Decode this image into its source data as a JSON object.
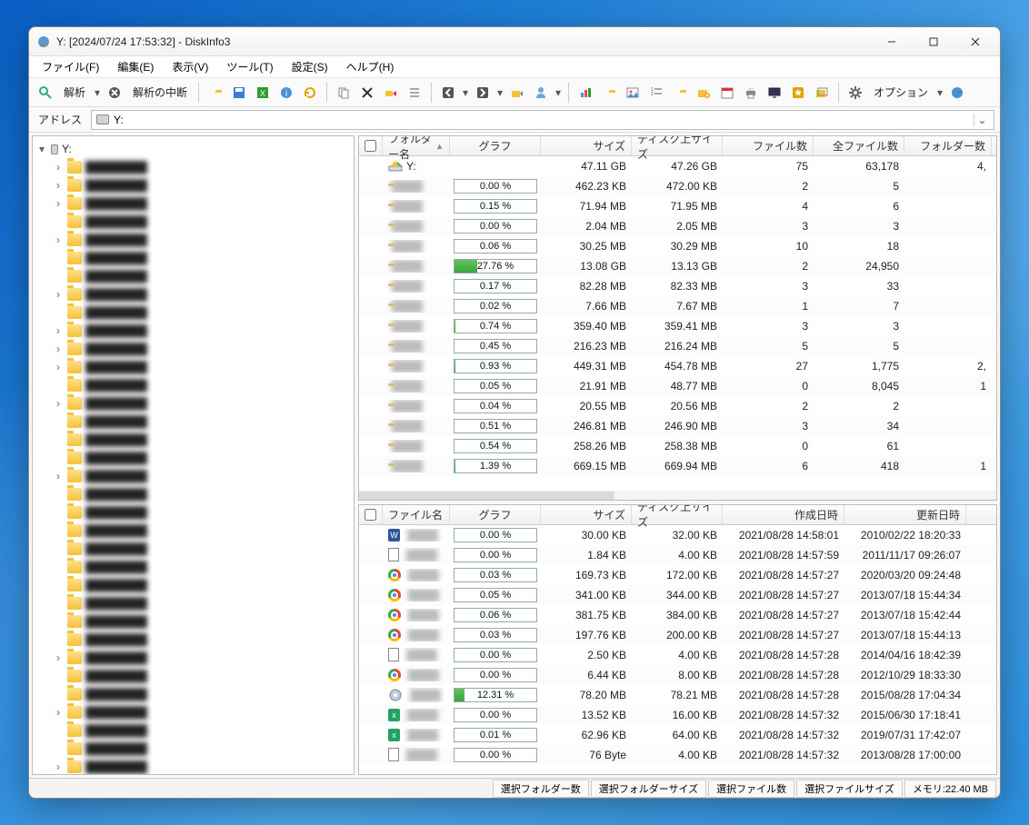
{
  "title": "Y: [2024/07/24 17:53:32] - DiskInfo3",
  "menu": [
    "ファイル(F)",
    "編集(E)",
    "表示(V)",
    "ツール(T)",
    "設定(S)",
    "ヘルプ(H)"
  ],
  "toolbar": {
    "analyze": "解析",
    "abort": "解析の中断",
    "options": "オプション"
  },
  "address": {
    "label": "アドレス",
    "value": "Y:"
  },
  "tree": {
    "root": "Y:"
  },
  "folderPane": {
    "headers": {
      "name": "フォルダー名",
      "graph": "グラフ",
      "size": "サイズ",
      "dsize": "ディスク上サイズ",
      "files": "ファイル数",
      "allfiles": "全ファイル数",
      "folders": "フォルダー数"
    },
    "rows": [
      {
        "icon": "drive",
        "name": "Y:",
        "pct": null,
        "size": "47.11 GB",
        "dsize": "47.26 GB",
        "files": "75",
        "allfiles": "63,178",
        "folders": "4,"
      },
      {
        "icon": "folder",
        "name": "",
        "pct": "0.00 %",
        "fill": 0,
        "size": "462.23 KB",
        "dsize": "472.00 KB",
        "files": "2",
        "allfiles": "5",
        "folders": ""
      },
      {
        "icon": "folder",
        "name": "",
        "pct": "0.15 %",
        "fill": 0.15,
        "size": "71.94 MB",
        "dsize": "71.95 MB",
        "files": "4",
        "allfiles": "6",
        "folders": ""
      },
      {
        "icon": "folder",
        "name": "",
        "pct": "0.00 %",
        "fill": 0,
        "size": "2.04 MB",
        "dsize": "2.05 MB",
        "files": "3",
        "allfiles": "3",
        "folders": ""
      },
      {
        "icon": "folder",
        "name": "",
        "pct": "0.06 %",
        "fill": 0.06,
        "size": "30.25 MB",
        "dsize": "30.29 MB",
        "files": "10",
        "allfiles": "18",
        "folders": ""
      },
      {
        "icon": "folder",
        "name": "",
        "pct": "27.76 %",
        "fill": 27.76,
        "size": "13.08 GB",
        "dsize": "13.13 GB",
        "files": "2",
        "allfiles": "24,950",
        "folders": ""
      },
      {
        "icon": "folder",
        "name": "",
        "pct": "0.17 %",
        "fill": 0.17,
        "size": "82.28 MB",
        "dsize": "82.33 MB",
        "files": "3",
        "allfiles": "33",
        "folders": ""
      },
      {
        "icon": "folder",
        "name": "",
        "pct": "0.02 %",
        "fill": 0.02,
        "size": "7.66 MB",
        "dsize": "7.67 MB",
        "files": "1",
        "allfiles": "7",
        "folders": ""
      },
      {
        "icon": "folder",
        "name": "",
        "pct": "0.74 %",
        "fill": 0.74,
        "size": "359.40 MB",
        "dsize": "359.41 MB",
        "files": "3",
        "allfiles": "3",
        "folders": ""
      },
      {
        "icon": "folder",
        "name": "",
        "pct": "0.45 %",
        "fill": 0.45,
        "size": "216.23 MB",
        "dsize": "216.24 MB",
        "files": "5",
        "allfiles": "5",
        "folders": ""
      },
      {
        "icon": "folder",
        "name": "",
        "pct": "0.93 %",
        "fill": 0.93,
        "size": "449.31 MB",
        "dsize": "454.78 MB",
        "files": "27",
        "allfiles": "1,775",
        "folders": "2,"
      },
      {
        "icon": "folder",
        "name": "",
        "pct": "0.05 %",
        "fill": 0.05,
        "size": "21.91 MB",
        "dsize": "48.77 MB",
        "files": "0",
        "allfiles": "8,045",
        "folders": "1"
      },
      {
        "icon": "folder",
        "name": "",
        "pct": "0.04 %",
        "fill": 0.04,
        "size": "20.55 MB",
        "dsize": "20.56 MB",
        "files": "2",
        "allfiles": "2",
        "folders": ""
      },
      {
        "icon": "folder",
        "name": "",
        "pct": "0.51 %",
        "fill": 0.51,
        "size": "246.81 MB",
        "dsize": "246.90 MB",
        "files": "3",
        "allfiles": "34",
        "folders": ""
      },
      {
        "icon": "folder",
        "name": "",
        "pct": "0.54 %",
        "fill": 0.54,
        "size": "258.26 MB",
        "dsize": "258.38 MB",
        "files": "0",
        "allfiles": "61",
        "folders": ""
      },
      {
        "icon": "folder",
        "name": "",
        "pct": "1.39 %",
        "fill": 1.39,
        "size": "669.15 MB",
        "dsize": "669.94 MB",
        "files": "6",
        "allfiles": "418",
        "folders": "1"
      }
    ]
  },
  "filePane": {
    "headers": {
      "name": "ファイル名",
      "graph": "グラフ",
      "size": "サイズ",
      "dsize": "ディスク上サイズ",
      "cdate": "作成日時",
      "mdate": "更新日時"
    },
    "rows": [
      {
        "icon": "word",
        "pct": "0.00 %",
        "fill": 0,
        "size": "30.00 KB",
        "dsize": "32.00 KB",
        "cdate": "2021/08/28 14:58:01",
        "mdate": "2010/02/22 18:20:33"
      },
      {
        "icon": "doc",
        "pct": "0.00 %",
        "fill": 0,
        "size": "1.84 KB",
        "dsize": "4.00 KB",
        "cdate": "2021/08/28 14:57:59",
        "mdate": "2011/11/17 09:26:07"
      },
      {
        "icon": "chrome",
        "pct": "0.03 %",
        "fill": 0.03,
        "size": "169.73 KB",
        "dsize": "172.00 KB",
        "cdate": "2021/08/28 14:57:27",
        "mdate": "2020/03/20 09:24:48"
      },
      {
        "icon": "chrome",
        "pct": "0.05 %",
        "fill": 0.05,
        "size": "341.00 KB",
        "dsize": "344.00 KB",
        "cdate": "2021/08/28 14:57:27",
        "mdate": "2013/07/18 15:44:34"
      },
      {
        "icon": "chrome",
        "pct": "0.06 %",
        "fill": 0.06,
        "size": "381.75 KB",
        "dsize": "384.00 KB",
        "cdate": "2021/08/28 14:57:27",
        "mdate": "2013/07/18 15:42:44"
      },
      {
        "icon": "chrome",
        "pct": "0.03 %",
        "fill": 0.03,
        "size": "197.76 KB",
        "dsize": "200.00 KB",
        "cdate": "2021/08/28 14:57:27",
        "mdate": "2013/07/18 15:44:13"
      },
      {
        "icon": "doc",
        "pct": "0.00 %",
        "fill": 0,
        "size": "2.50 KB",
        "dsize": "4.00 KB",
        "cdate": "2021/08/28 14:57:28",
        "mdate": "2014/04/16 18:42:39"
      },
      {
        "icon": "chrome",
        "pct": "0.00 %",
        "fill": 0,
        "size": "6.44 KB",
        "dsize": "8.00 KB",
        "cdate": "2021/08/28 14:57:28",
        "mdate": "2012/10/29 18:33:30"
      },
      {
        "icon": "disk",
        "pct": "12.31 %",
        "fill": 12.31,
        "size": "78.20 MB",
        "dsize": "78.21 MB",
        "cdate": "2021/08/28 14:57:28",
        "mdate": "2015/08/28 17:04:34"
      },
      {
        "icon": "xls",
        "pct": "0.00 %",
        "fill": 0,
        "size": "13.52 KB",
        "dsize": "16.00 KB",
        "cdate": "2021/08/28 14:57:32",
        "mdate": "2015/06/30 17:18:41"
      },
      {
        "icon": "xls",
        "pct": "0.01 %",
        "fill": 0.01,
        "size": "62.96 KB",
        "dsize": "64.00 KB",
        "cdate": "2021/08/28 14:57:32",
        "mdate": "2019/07/31 17:42:07"
      },
      {
        "icon": "doc",
        "pct": "0.00 %",
        "fill": 0,
        "size": "76 Byte",
        "dsize": "4.00 KB",
        "cdate": "2021/08/28 14:57:32",
        "mdate": "2013/08/28 17:00:00"
      }
    ]
  },
  "status": {
    "selFolders": "選択フォルダー数",
    "selFolderSize": "選択フォルダーサイズ",
    "selFiles": "選択ファイル数",
    "selFileSize": "選択ファイルサイズ",
    "memLabel": "メモリ:",
    "memValue": "22.40 MB"
  }
}
